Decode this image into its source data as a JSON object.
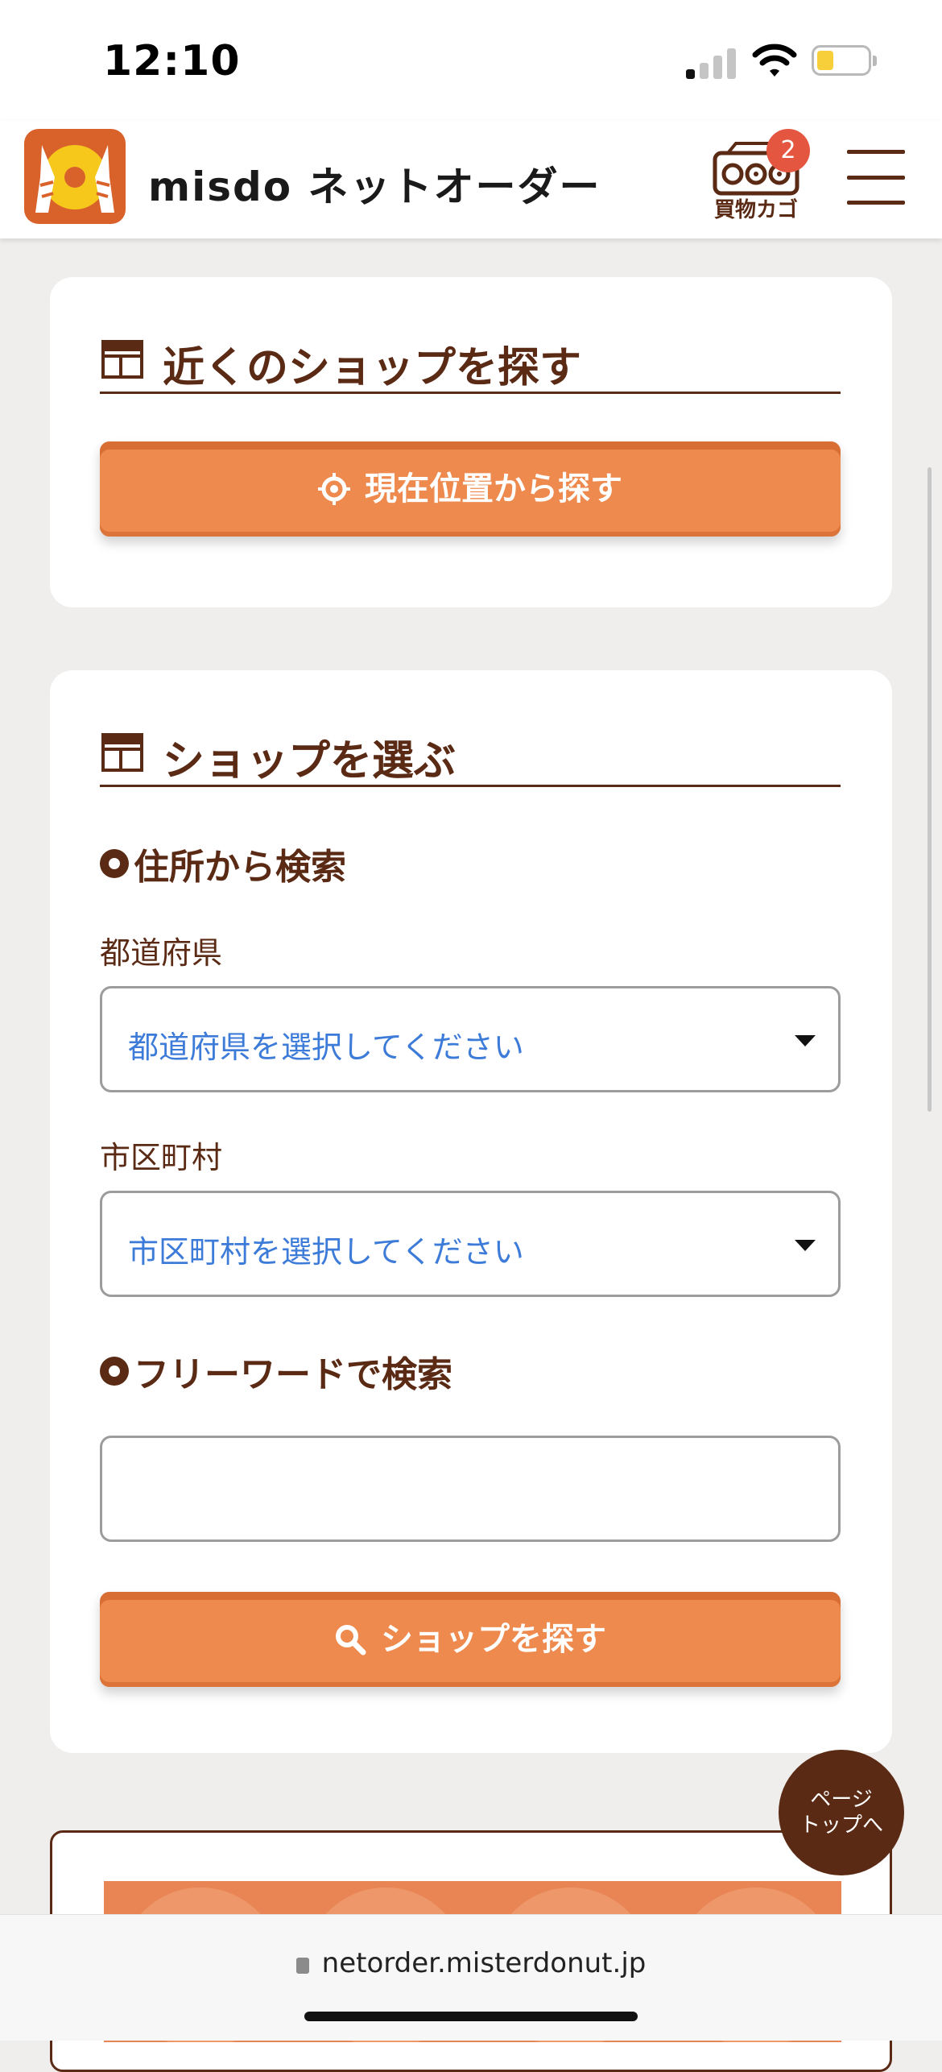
{
  "status_bar": {
    "time": "12:10"
  },
  "header": {
    "brand": "misdo ネットオーダー",
    "cart_label": "買物カゴ",
    "cart_count": "2"
  },
  "nearby": {
    "title": "近くのショップを探す",
    "locate_button": "現在位置から探す"
  },
  "select_shop": {
    "title": "ショップを選ぶ",
    "address_heading": "住所から検索",
    "prefecture_label": "都道府県",
    "prefecture_value": "都道府県を選択してください",
    "city_label": "市区町村",
    "city_value": "市区町村を選択してください",
    "freeword_heading": "フリーワードで検索",
    "freeword_value": "",
    "search_button": "ショップを探す"
  },
  "page_top": {
    "line1": "ページ",
    "line2": "トップへ"
  },
  "browser": {
    "url": "netorder.misterdonut.jp"
  }
}
